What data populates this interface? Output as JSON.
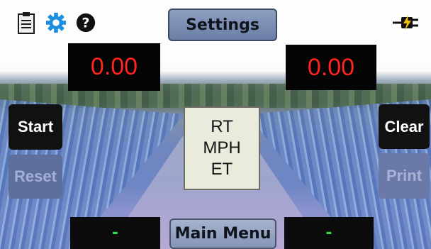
{
  "header": {
    "settings_label": "Settings",
    "icons": [
      "clipboard-icon",
      "gear-icon",
      "help-icon",
      "power-plug-icon"
    ]
  },
  "displays": {
    "left_value": "0.00",
    "right_value": "0.00",
    "left_status": "-",
    "right_status": "-"
  },
  "buttons": {
    "start": "Start",
    "reset": "Reset",
    "clear": "Clear",
    "print": "Print",
    "main_menu": "Main Menu"
  },
  "center_labels": {
    "rt": "RT",
    "mph": "MPH",
    "et": "ET"
  },
  "colors": {
    "display_text": "#ff2420",
    "status_text": "#2ce04a",
    "accent_blue": "#1c8fe0"
  }
}
